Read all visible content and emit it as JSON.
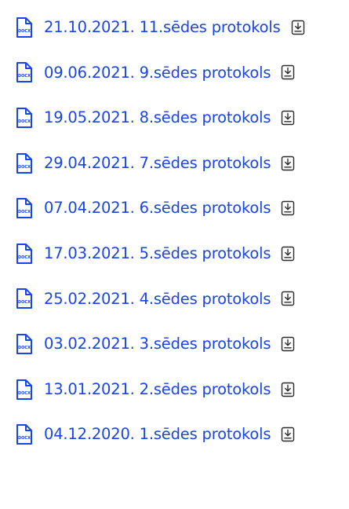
{
  "colors": {
    "link": "#1a45e6",
    "icon_stroke": "#1a45e6",
    "download_icon": "#2b2b2b",
    "background": "#ffffff"
  },
  "icons": {
    "file": "docx-file-icon",
    "download": "download-icon"
  },
  "documents": [
    {
      "title": "21.10.2021. 11.sēdes protokols",
      "file_type": "DOCX"
    },
    {
      "title": "09.06.2021. 9.sēdes protokols",
      "file_type": "DOCX"
    },
    {
      "title": "19.05.2021. 8.sēdes protokols",
      "file_type": "DOCX"
    },
    {
      "title": "29.04.2021. 7.sēdes protokols",
      "file_type": "DOCX"
    },
    {
      "title": "07.04.2021. 6.sēdes protokols",
      "file_type": "DOCX"
    },
    {
      "title": "17.03.2021. 5.sēdes protokols",
      "file_type": "DOCX"
    },
    {
      "title": "25.02.2021. 4.sēdes protokols",
      "file_type": "DOCX"
    },
    {
      "title": "03.02.2021. 3.sēdes protokols",
      "file_type": "DOCX"
    },
    {
      "title": "13.01.2021. 2.sēdes protokols",
      "file_type": "DOCX"
    },
    {
      "title": "04.12.2020. 1.sēdes protokols",
      "file_type": "DOCX"
    }
  ]
}
